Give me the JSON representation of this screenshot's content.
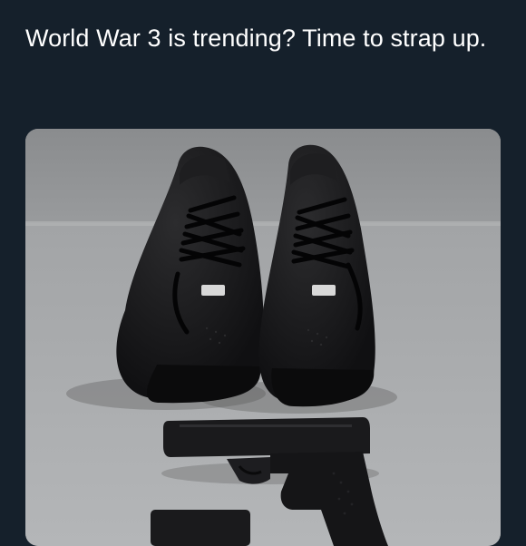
{
  "tweet": {
    "text": "World War 3 is trending? Time to strap up."
  },
  "media": {
    "kind": "photo",
    "subject_icons": [
      "sneakers-icon",
      "handgun-icon"
    ]
  },
  "colors": {
    "background": "#15202b",
    "text": "#ffffff"
  }
}
